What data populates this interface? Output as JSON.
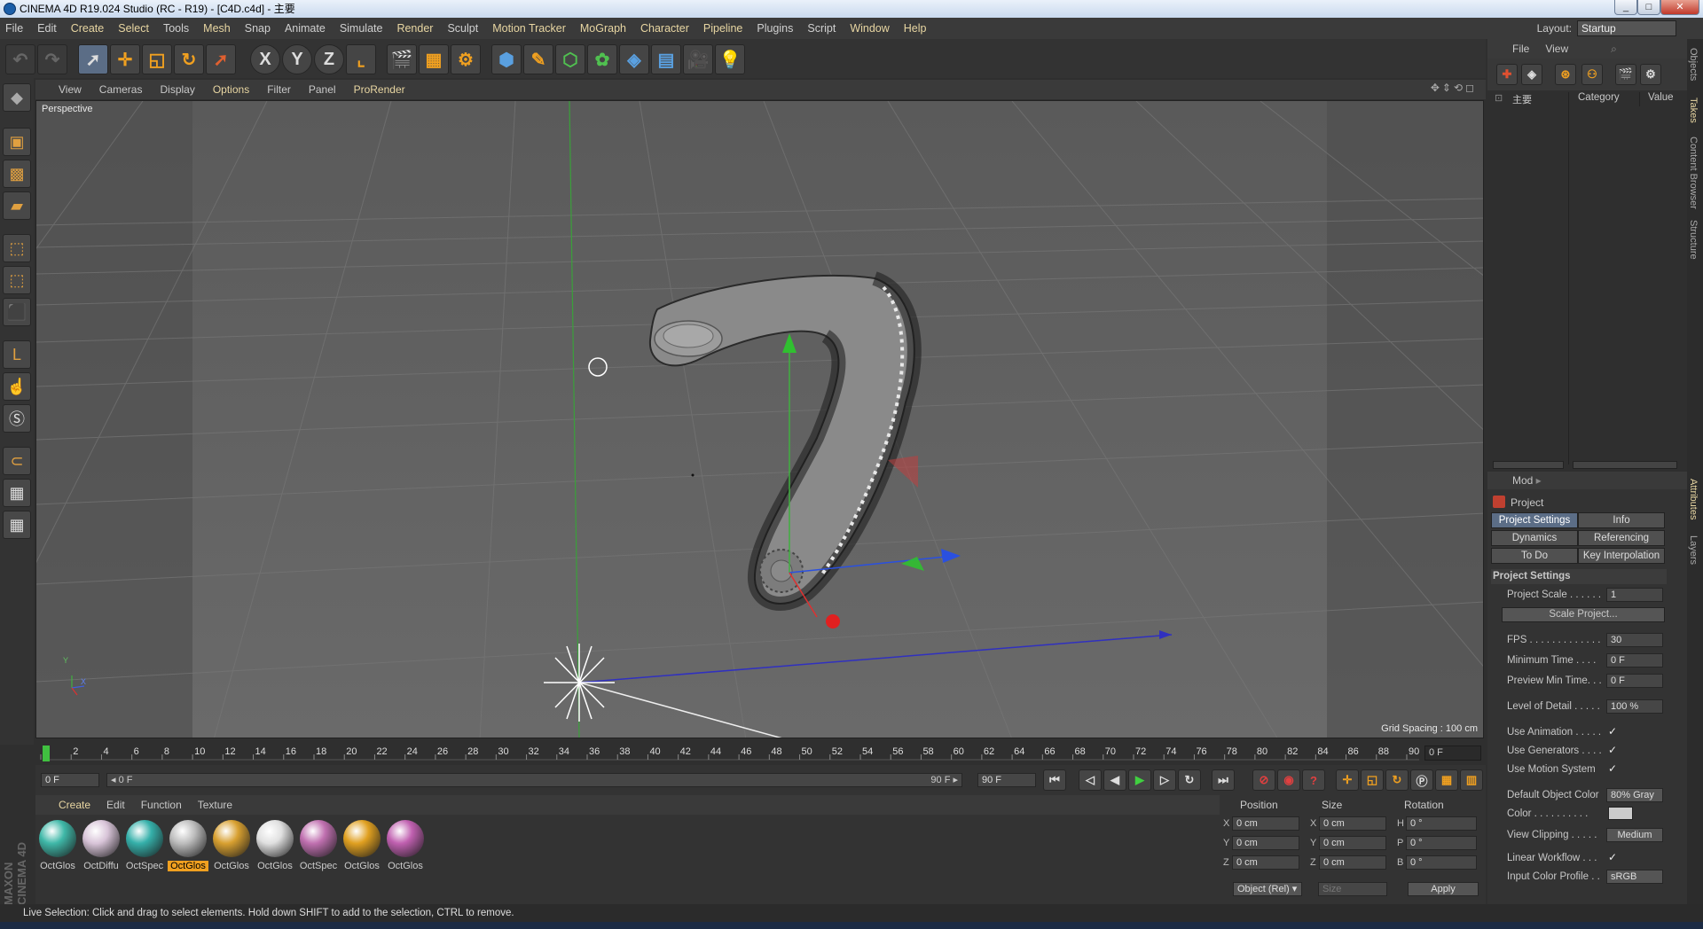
{
  "window": {
    "title": "CINEMA 4D R19.024 Studio (RC - R19) - [C4D.c4d] - 主要",
    "min": "_",
    "max": "□",
    "close": "✕"
  },
  "menu": [
    "File",
    "Edit",
    "Create",
    "Select",
    "Tools",
    "Mesh",
    "Snap",
    "Animate",
    "Simulate",
    "Render",
    "Sculpt",
    "Motion Tracker",
    "MoGraph",
    "Character",
    "Pipeline",
    "Plugins",
    "Script",
    "Window",
    "Help"
  ],
  "layout": {
    "label": "Layout:",
    "value": "Startup"
  },
  "toolbar": {
    "x_label": "X",
    "y_label": "Y",
    "z_label": "Z"
  },
  "viewport": {
    "menu": [
      "View",
      "Cameras",
      "Display",
      "Options",
      "Filter",
      "Panel",
      "ProRender"
    ],
    "camera": "Perspective",
    "grid_spacing": "Grid Spacing : 100 cm",
    "axis_y": "Y",
    "axis_x": "X"
  },
  "timeline": {
    "ticks": [
      "0",
      "2",
      "4",
      "6",
      "8",
      "10",
      "12",
      "14",
      "16",
      "18",
      "20",
      "22",
      "24",
      "26",
      "28",
      "30",
      "32",
      "34",
      "36",
      "38",
      "40",
      "42",
      "44",
      "46",
      "48",
      "50",
      "52",
      "54",
      "56",
      "58",
      "60",
      "62",
      "64",
      "66",
      "68",
      "70",
      "72",
      "74",
      "76",
      "78",
      "80",
      "82",
      "84",
      "86",
      "88",
      "90"
    ],
    "current_frame": "0 F",
    "start_field": "0 F",
    "range_start": "◂ 0 F",
    "range_end": "90 F ▸",
    "end_field": "90 F"
  },
  "materials": {
    "menu": [
      "Create",
      "Edit",
      "Function",
      "Texture"
    ],
    "items": [
      {
        "label": "OctGlos",
        "color": "#3fb8a8"
      },
      {
        "label": "OctDiffu",
        "color": "#d8c4d8"
      },
      {
        "label": "OctSpec",
        "color": "#35b0aa"
      },
      {
        "label": "OctGlos",
        "color": "#bdbdbd"
      },
      {
        "label": "OctGlos",
        "color": "#d8a030"
      },
      {
        "label": "OctGlos",
        "color": "#e0e0e0"
      },
      {
        "label": "OctSpec",
        "color": "#c070b0"
      },
      {
        "label": "OctGlos",
        "color": "#e0a020"
      },
      {
        "label": "OctGlos",
        "color": "#c060b0"
      }
    ]
  },
  "coords": {
    "headers": [
      "Position",
      "Size",
      "Rotation"
    ],
    "rows": [
      {
        "a": "X",
        "pos": "0 cm",
        "b": "X",
        "size": "0 cm",
        "c": "H",
        "rot": "0 °"
      },
      {
        "a": "Y",
        "pos": "0 cm",
        "b": "Y",
        "size": "0 cm",
        "c": "P",
        "rot": "0 °"
      },
      {
        "a": "Z",
        "pos": "0 cm",
        "b": "Z",
        "size": "0 cm",
        "c": "B",
        "rot": "0 °"
      }
    ],
    "mode": "Object (Rel) ▾",
    "size_mode": "Size",
    "apply": "Apply"
  },
  "objects": {
    "menu": [
      "File",
      "View"
    ],
    "takes_root": "主要",
    "col_category": "Category",
    "col_value": "Value"
  },
  "attributes": {
    "mode": "Mod",
    "object": "Project",
    "tabs": [
      "Project Settings",
      "Info",
      "Dynamics",
      "Referencing",
      "To Do",
      "Key Interpolation"
    ],
    "section": "Project Settings",
    "rows": [
      {
        "label": "Project Scale . . . . . .",
        "value": "1"
      },
      {
        "label": "FPS . . . . . . . . . . . . .",
        "value": "30"
      },
      {
        "label": "Minimum Time . . . .",
        "value": "0 F"
      },
      {
        "label": "Preview Min Time. . .",
        "value": "0 F"
      },
      {
        "label": "Level of Detail . . . . .",
        "value": "100 %"
      }
    ],
    "scale_button": "Scale Project...",
    "checks": [
      {
        "label": "Use Animation . . . . .",
        "value": "✓"
      },
      {
        "label": "Use Generators . . . .",
        "value": "✓"
      },
      {
        "label": "Use Motion System",
        "value": "✓"
      }
    ],
    "default_color_label": "Default Object Color",
    "default_color_value": "80% Gray",
    "color_label": "Color . . . . . . . . . .",
    "view_clipping_label": "View Clipping . . . . .",
    "view_clipping_value": "Medium",
    "linear_label": "Linear Workflow . . .",
    "linear_value": "✓",
    "profile_label": "Input Color Profile . .",
    "profile_value": "sRGB"
  },
  "side_tabs": [
    "Objects",
    "Takes",
    "Content Browser",
    "Structure",
    "Attributes",
    "Layers"
  ],
  "status": "Live Selection: Click and drag to select elements. Hold down SHIFT to add to the selection, CTRL to remove.",
  "brand": "MAXON CINEMA 4D"
}
